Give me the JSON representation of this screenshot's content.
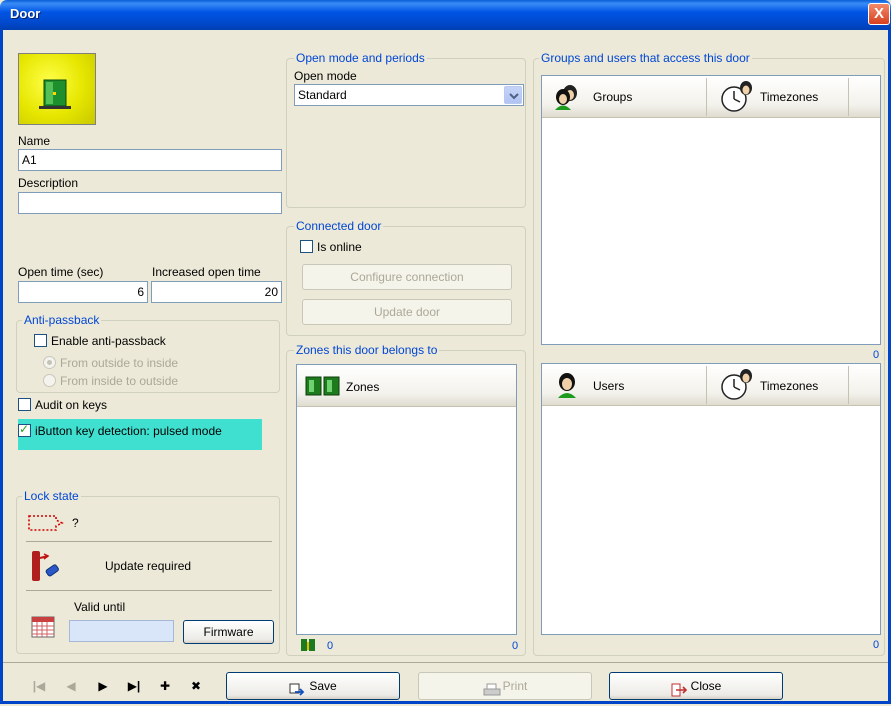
{
  "window": {
    "title": "Door",
    "close_glyph": "X"
  },
  "left": {
    "name_label": "Name",
    "name_value": "A1",
    "description_label": "Description",
    "description_value": "",
    "open_time_label": "Open time (sec)",
    "open_time_value": "6",
    "increased_open_time_label": "Increased open time",
    "increased_open_time_value": "20",
    "anti_passback": {
      "legend": "Anti-passback",
      "enable_label": "Enable anti-passback",
      "outside_to_inside": "From outside to inside",
      "inside_to_outside": "From inside to outside"
    },
    "audit_label": "Audit on keys",
    "ibutton_label": "iButton key detection: pulsed mode",
    "lock_state": {
      "legend": "Lock state",
      "state_symbol": "?",
      "update_text": "Update required",
      "valid_until_label": "Valid until",
      "valid_until_value": "",
      "firmware_label": "Firmware"
    }
  },
  "middle": {
    "open_mode_group": {
      "legend": "Open mode and periods",
      "label": "Open mode",
      "value": "Standard"
    },
    "connected_door": {
      "legend": "Connected door",
      "is_online_label": "Is online",
      "configure_label": "Configure connection",
      "update_label": "Update door"
    },
    "zones": {
      "legend": "Zones this door belongs to",
      "header": "Zones",
      "footer_count": "0",
      "count": "0"
    }
  },
  "right": {
    "legend": "Groups and users that access this door",
    "groups_header": "Groups",
    "groups_tz_header": "Timezones",
    "groups_count": "0",
    "users_header": "Users",
    "users_tz_header": "Timezones",
    "users_count": "0"
  },
  "toolbar": {
    "first": "|◀",
    "prev": "◀",
    "next": "▶",
    "last": "▶|",
    "add": "✚",
    "delete": "✖",
    "save_label": "Save",
    "print_label": "Print",
    "close_label": "Close"
  },
  "icons": {
    "door": "door-icon",
    "groups": "groups-icon",
    "users": "users-icon",
    "timezones": "clock-icon",
    "zones": "zones-icon",
    "lock": "lock-icon",
    "calendar": "calendar-icon"
  },
  "colors": {
    "accent": "#0046d5",
    "highlight": "#40e0d0",
    "titlebar": "#0055e5",
    "door_icon_bg": "#e6e600"
  }
}
